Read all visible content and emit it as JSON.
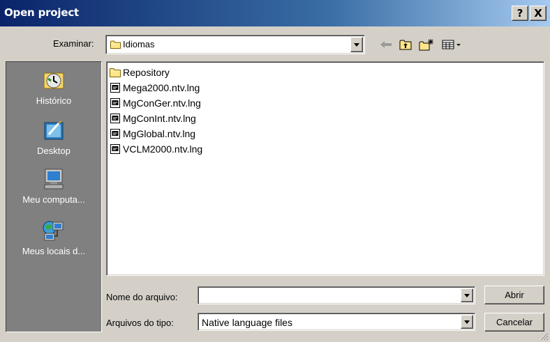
{
  "window": {
    "title": "Open project",
    "help_label": "?",
    "close_label": "X"
  },
  "lookin": {
    "label": "Examinar:",
    "value": "Idiomas"
  },
  "toolbar": {
    "back_icon": "back-arrow-icon",
    "up_icon": "up-folder-icon",
    "newfolder_icon": "new-folder-icon",
    "views_icon": "views-menu-icon"
  },
  "places": [
    {
      "label": "Histórico",
      "icon": "history-icon"
    },
    {
      "label": "Desktop",
      "icon": "desktop-icon"
    },
    {
      "label": "Meu computa...",
      "icon": "my-computer-icon"
    },
    {
      "label": "Meus locais d...",
      "icon": "network-places-icon"
    }
  ],
  "files": [
    {
      "name": "Repository",
      "kind": "folder"
    },
    {
      "name": "Mega2000.ntv.lng",
      "kind": "file"
    },
    {
      "name": "MgConGer.ntv.lng",
      "kind": "file"
    },
    {
      "name": "MgConInt.ntv.lng",
      "kind": "file"
    },
    {
      "name": "MgGlobal.ntv.lng",
      "kind": "file"
    },
    {
      "name": "VCLM2000.ntv.lng",
      "kind": "file"
    }
  ],
  "filename": {
    "label": "Nome do arquivo:",
    "value": ""
  },
  "filetype": {
    "label": "Arquivos do tipo:",
    "value": "Native language files"
  },
  "buttons": {
    "open": "Abrir",
    "cancel": "Cancelar"
  },
  "colors": {
    "titlebar_start": "#0a246a",
    "titlebar_end": "#a6caf0",
    "face": "#d4d0c8",
    "places_bg": "#808080"
  }
}
